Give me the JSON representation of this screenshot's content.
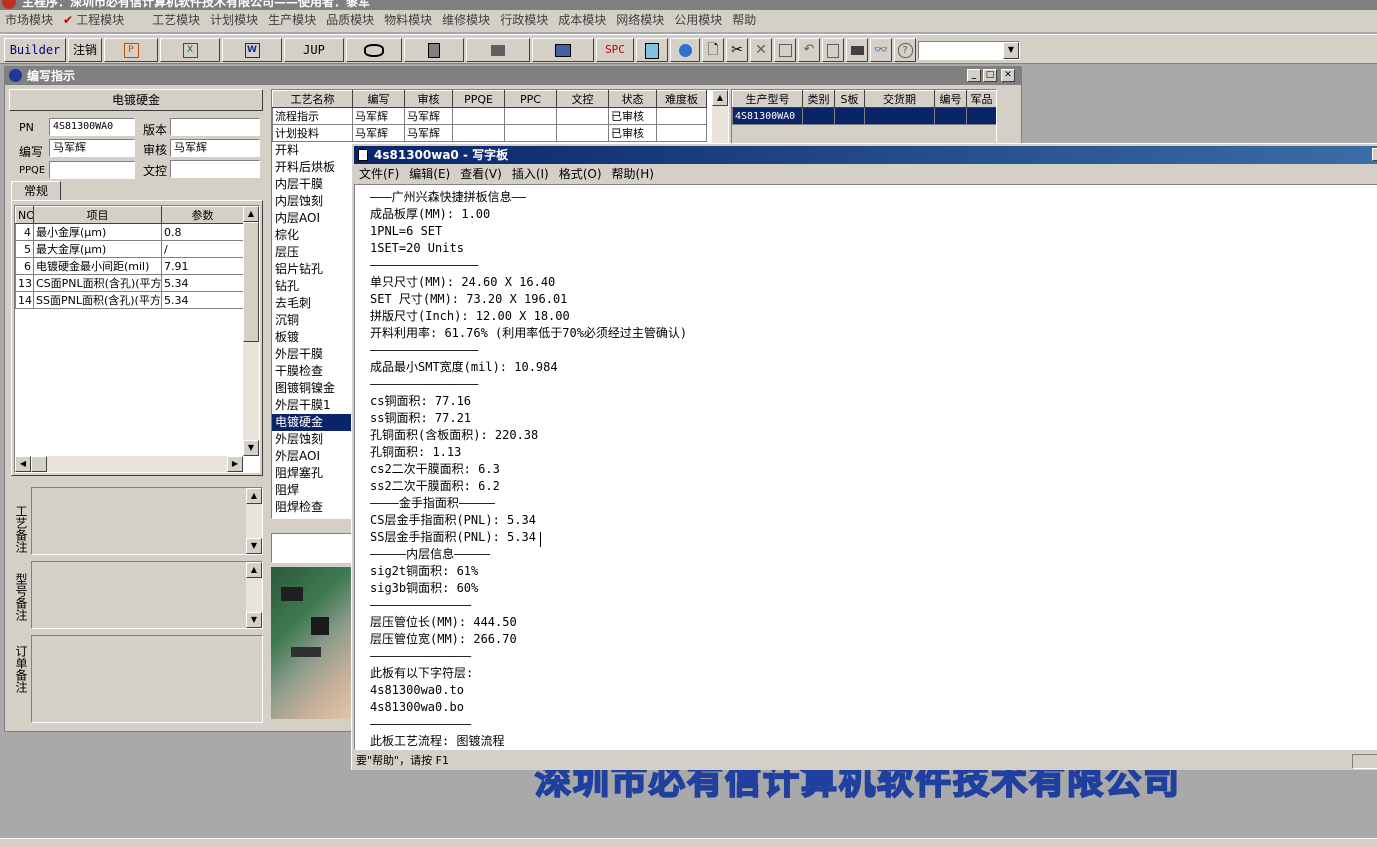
{
  "app": {
    "title": "主程序：深圳市必有信计算机软件技术有限公司——使用者：黎军"
  },
  "menu": [
    "市场模块",
    "工程模块",
    "工艺模块",
    "计划模块",
    "生产模块",
    "品质模块",
    "物料模块",
    "维修模块",
    "行政模块",
    "成本模块",
    "网络模块",
    "公用模块",
    "帮助"
  ],
  "toolbar": {
    "builder": "Builder",
    "logout": "注销",
    "jup": "JUP",
    "spc": "SPC"
  },
  "mdi": {
    "title": "编写指示"
  },
  "left_panel": {
    "header": "电镀硬金",
    "pn_label": "PN",
    "pn_value": "4S81300WA0",
    "version_label": "版本",
    "version_value": "",
    "writer_label": "编写",
    "writer_value": "马军辉",
    "reviewer_label": "审核",
    "reviewer_value": "马军辉",
    "ppqe_label": "PPQE",
    "ppqe_value": "",
    "doc_label": "文控",
    "doc_value": "",
    "tab": "常规",
    "param_headers": [
      "NO",
      "项目",
      "参数"
    ],
    "params": [
      {
        "no": "4",
        "item": "最小金厚(μm)",
        "value": "0.8"
      },
      {
        "no": "5",
        "item": "最大金厚(μm)",
        "value": "/"
      },
      {
        "no": "6",
        "item": "电镀硬金最小间距(mil)",
        "value": "7.91"
      },
      {
        "no": "13",
        "item": "CS面PNL面积(含孔)(平方",
        "value": "5.34"
      },
      {
        "no": "14",
        "item": "SS面PNL面积(含孔)(平方",
        "value": "5.34"
      }
    ],
    "notes": {
      "process": "工艺备注",
      "model": "型号备注",
      "order": "订单备注"
    }
  },
  "process_table": {
    "headers": [
      "工艺名称",
      "编写",
      "审核",
      "PPQE",
      "PPC",
      "文控",
      "状态",
      "难度板"
    ],
    "rows": [
      {
        "name": "流程指示",
        "writer": "马军辉",
        "reviewer": "马军辉",
        "status": "已审核"
      },
      {
        "name": "计划投料",
        "writer": "马军辉",
        "reviewer": "马军辉",
        "status": "已审核"
      }
    ],
    "items": [
      "开料",
      "开料后烘板",
      "内层干膜",
      "内层蚀刻",
      "内层AOI",
      "棕化",
      "层压",
      "铝片钻孔",
      "钻孔",
      "去毛刺",
      "沉铜",
      "板镀",
      "外层干膜",
      "干膜检查",
      "图镀铜镍金",
      "外层干膜1",
      "电镀硬金",
      "外层蚀刻",
      "外层AOI",
      "阻焊塞孔",
      "阻焊",
      "阻焊检查"
    ],
    "selected": "电镀硬金"
  },
  "right_table": {
    "headers": [
      "生产型号",
      "类别",
      "S板",
      "交货期",
      "编号",
      "军品"
    ],
    "row": [
      "4S81300WA0",
      "",
      "",
      "",
      "",
      ""
    ]
  },
  "wordpad": {
    "title": "4s81300wa0 - 写字板",
    "menu": [
      "文件(F)",
      "编辑(E)",
      "查看(V)",
      "插入(I)",
      "格式(O)",
      "帮助(H)"
    ],
    "lines": [
      "———广州兴森快捷拼板信息——",
      "成品板厚(MM): 1.00",
      "1PNL=6 SET",
      "1SET=20 Units",
      "———————————————",
      "单只尺寸(MM): 24.60 X 16.40",
      "SET 尺寸(MM): 73.20 X 196.01",
      "拼版尺寸(Inch): 12.00 X 18.00",
      "开料利用率: 61.76% (利用率低于70%必须经过主管确认)",
      "———————————————",
      "成品最小SMT宽度(mil): 10.984",
      "———————————————",
      "cs铜面积: 77.16",
      "ss铜面积: 77.21",
      "孔铜面积(含板面积): 220.38",
      "孔铜面积: 1.13",
      "cs2二次干膜面积: 6.3",
      "ss2二次干膜面积: 6.2",
      "————金手指面积—————",
      "CS层金手指面积(PNL): 5.34",
      "SS层金手指面积(PNL): 5.34",
      "—————内层信息—————",
      "sig2t铜面积: 61%",
      "sig3b铜面积: 60%",
      "——————————————",
      "层压管位长(MM): 444.50",
      "层压管位宽(MM): 266.70",
      "——————————————",
      "此板有以下字符层:",
      "4s81300wa0.to",
      "4s81300wa0.bo",
      "——————————————",
      "此板工艺流程: 图镀流程"
    ],
    "status": "要\"帮助\"，请按 F1"
  },
  "background": {
    "company_text": "深圳市必有信计算机软件技术有限公司"
  },
  "colors": {
    "face": "#d4d0c8",
    "selection": "#0a246a",
    "title_inactive": "#808080",
    "wordpad_title": "#0a246a",
    "watermark": "#2040a0"
  }
}
